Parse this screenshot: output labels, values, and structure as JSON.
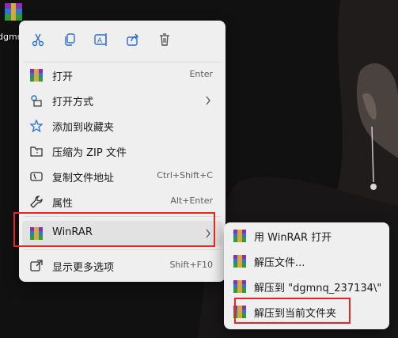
{
  "desktop": {
    "file_label": "dgmnq"
  },
  "menu": {
    "toolbar": [
      "cut-icon",
      "copy-icon",
      "rename-icon",
      "share-icon",
      "delete-icon"
    ],
    "items": [
      {
        "label": "打开",
        "shortcut": "Enter"
      },
      {
        "label": "打开方式",
        "shortcut": ""
      },
      {
        "label": "添加到收藏夹",
        "shortcut": ""
      },
      {
        "label": "压缩为 ZIP 文件",
        "shortcut": ""
      },
      {
        "label": "复制文件地址",
        "shortcut": "Ctrl+Shift+C"
      },
      {
        "label": "属性",
        "shortcut": "Alt+Enter"
      },
      {
        "label": "WinRAR",
        "shortcut": ""
      },
      {
        "label": "显示更多选项",
        "shortcut": "Shift+F10"
      }
    ]
  },
  "submenu": {
    "items": [
      {
        "label": "用 WinRAR 打开"
      },
      {
        "label": "解压文件..."
      },
      {
        "label": "解压到 \"dgmnq_237134\\\""
      },
      {
        "label": "解压到当前文件夹"
      }
    ]
  },
  "colors": {
    "highlight_box": "#e02828",
    "menu_bg": "#efefef"
  }
}
